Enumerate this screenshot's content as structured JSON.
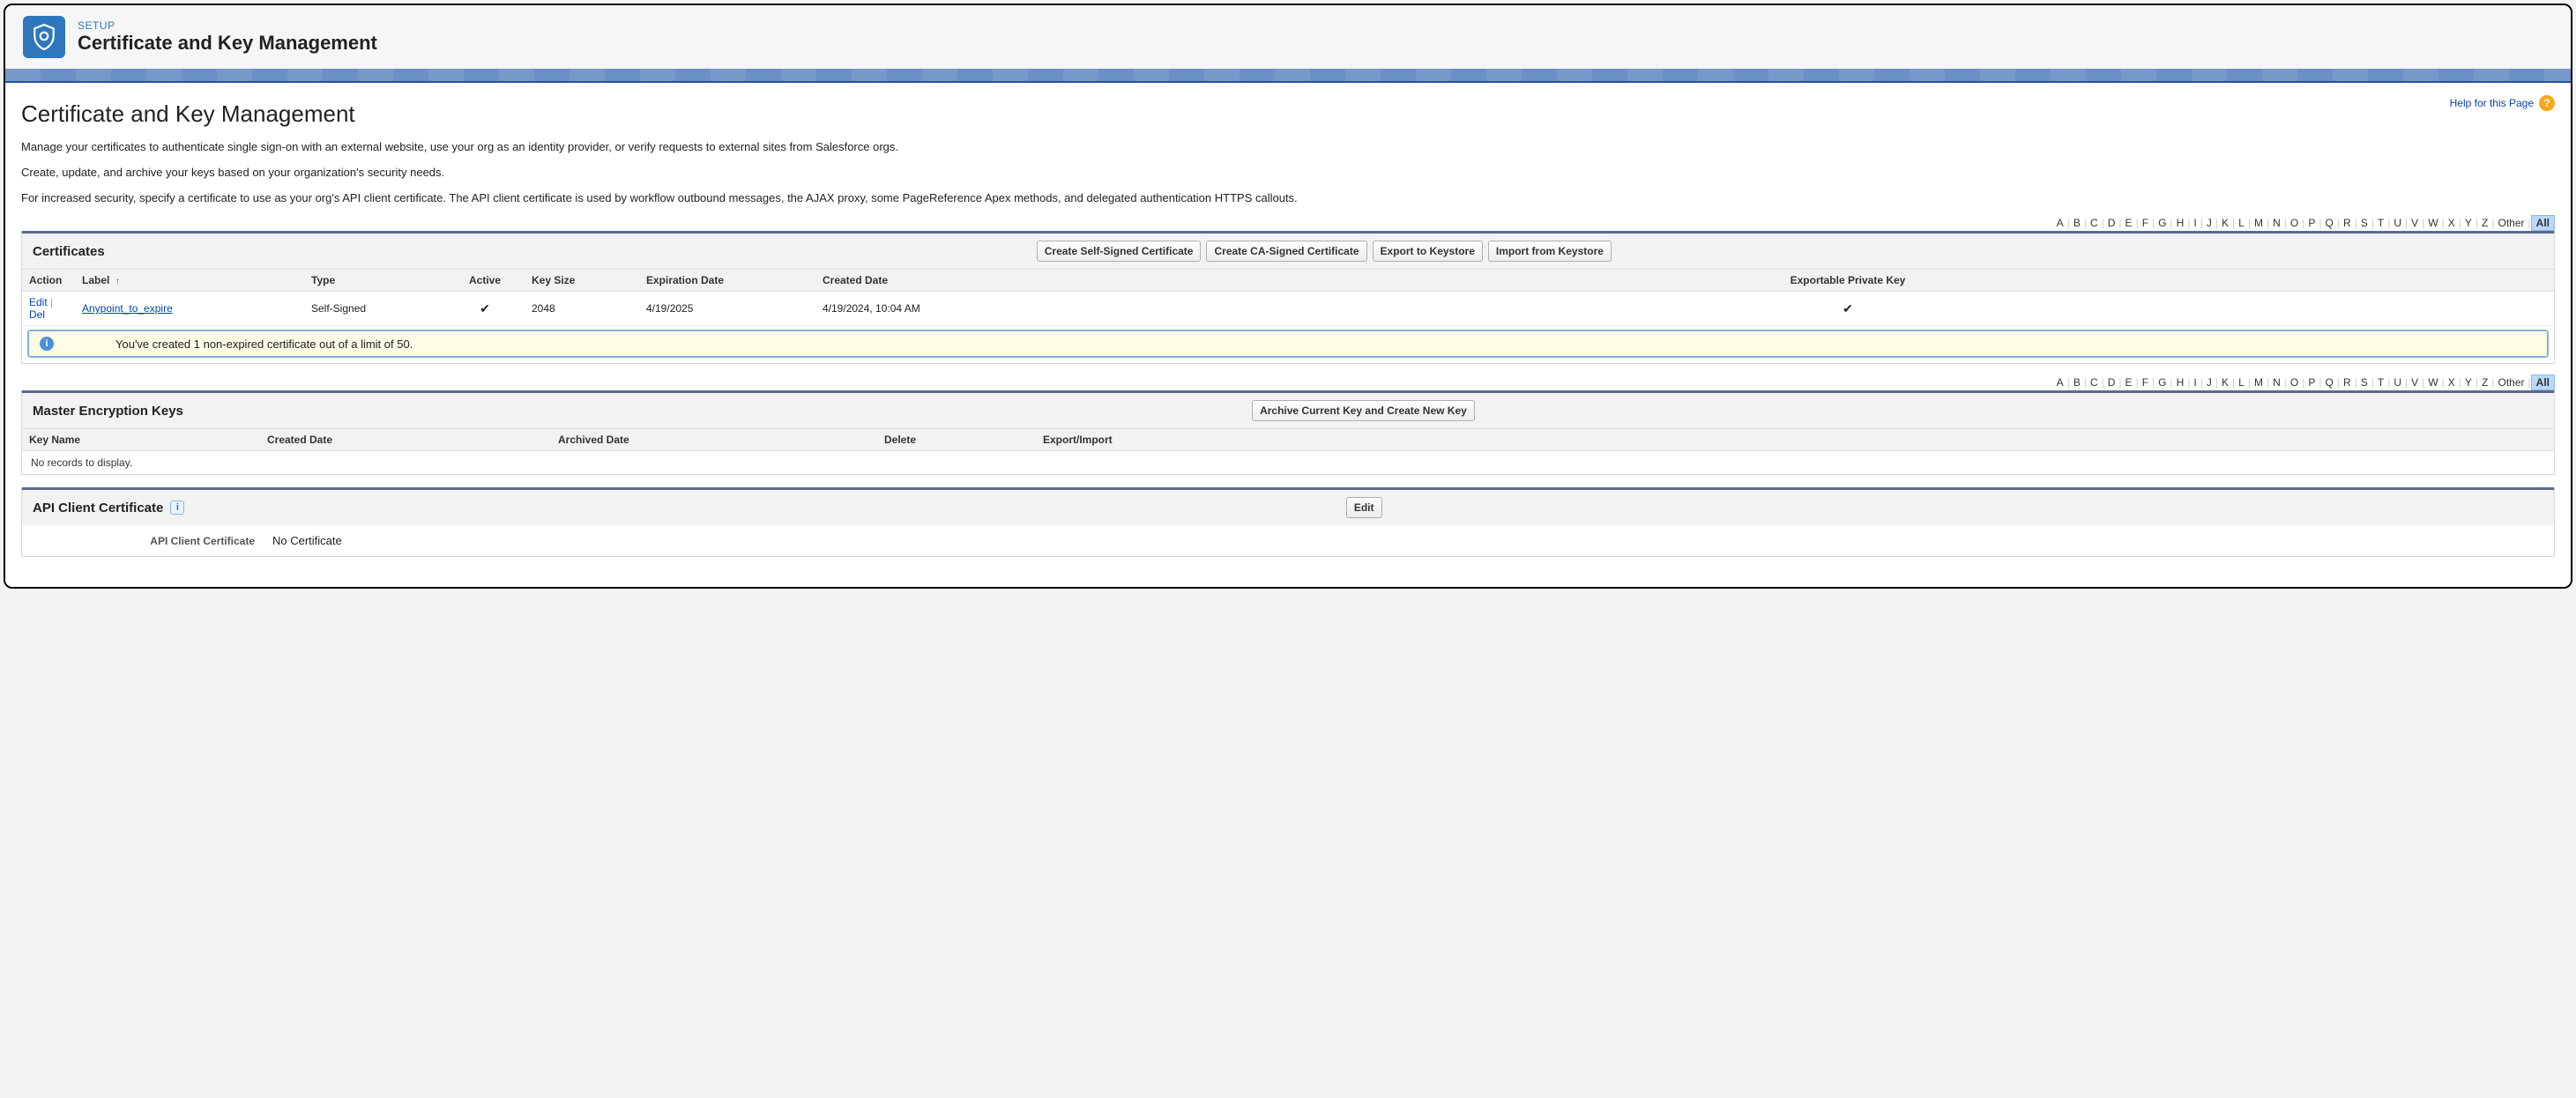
{
  "header": {
    "setup_label": "SETUP",
    "title": "Certificate and Key Management"
  },
  "help_link": "Help for this Page",
  "page_heading": "Certificate and Key Management",
  "desc": {
    "p1": "Manage your certificates to authenticate single sign-on with an external website, use your org as an identity provider, or verify requests to external sites from Salesforce orgs.",
    "p2": "Create, update, and archive your keys based on your organization's security needs.",
    "p3": "For increased security, specify a certificate to use as your org's API client certificate. The API client certificate is used by workflow outbound messages, the AJAX proxy, some PageReference Apex methods, and delegated authentication HTTPS callouts."
  },
  "alpha": {
    "letters": [
      "A",
      "B",
      "C",
      "D",
      "E",
      "F",
      "G",
      "H",
      "I",
      "J",
      "K",
      "L",
      "M",
      "N",
      "O",
      "P",
      "Q",
      "R",
      "S",
      "T",
      "U",
      "V",
      "W",
      "X",
      "Y",
      "Z"
    ],
    "other": "Other",
    "all": "All"
  },
  "certificates": {
    "title": "Certificates",
    "buttons": {
      "self_signed": "Create Self-Signed Certificate",
      "ca_signed": "Create CA-Signed Certificate",
      "export": "Export to Keystore",
      "import": "Import from Keystore"
    },
    "columns": {
      "action": "Action",
      "label": "Label",
      "type": "Type",
      "active": "Active",
      "key_size": "Key Size",
      "expiration": "Expiration Date",
      "created": "Created Date",
      "exportable": "Exportable Private Key"
    },
    "rows": [
      {
        "edit": "Edit",
        "del": "Del",
        "label": "Anypoint_to_expire",
        "type": "Self-Signed",
        "active": true,
        "key_size": "2048",
        "expiration": "4/19/2025",
        "created": "4/19/2024, 10:04 AM",
        "exportable": true
      }
    ],
    "info": "You've created 1 non-expired certificate out of a limit of 50."
  },
  "master_keys": {
    "title": "Master Encryption Keys",
    "buttons": {
      "archive_new": "Archive Current Key and Create New Key"
    },
    "columns": {
      "key_name": "Key Name",
      "created": "Created Date",
      "archived": "Archived Date",
      "delete": "Delete",
      "export_import": "Export/Import"
    },
    "no_records": "No records to display."
  },
  "api_client": {
    "title": "API Client Certificate",
    "edit_btn": "Edit",
    "field_label": "API Client Certificate",
    "field_value": "No Certificate"
  }
}
